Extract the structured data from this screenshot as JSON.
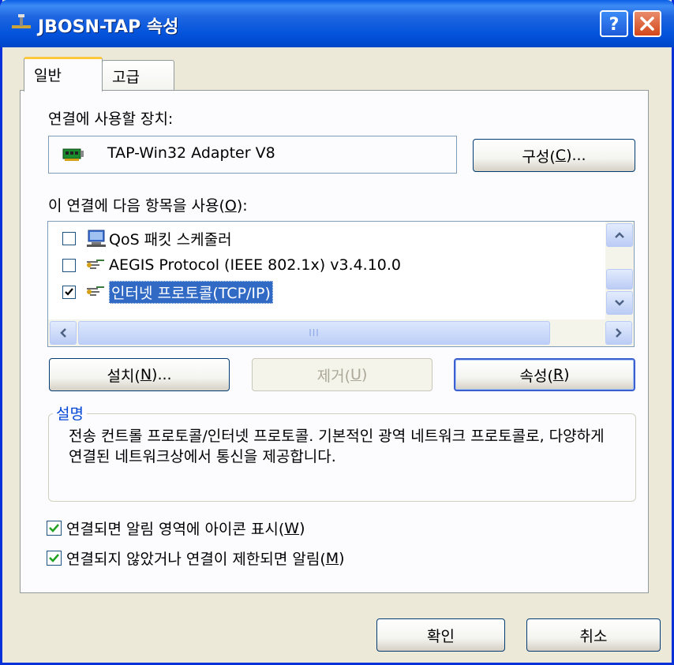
{
  "window": {
    "title": "JBOSN-TAP 속성",
    "help_icon": "help-icon",
    "close_icon": "close-icon"
  },
  "tabs": [
    {
      "label": "일반",
      "active": true
    },
    {
      "label": "고급",
      "active": false
    }
  ],
  "device": {
    "label": "연결에 사용할 장치:",
    "name": "TAP-Win32 Adapter V8",
    "icon": "network-adapter-icon",
    "configure_button": {
      "text": "구성(",
      "key": "C",
      "suffix": ")..."
    }
  },
  "items_section": {
    "label_text": "이 연결에 다음 항목을 사용(",
    "label_key": "O",
    "label_suffix": "):",
    "items": [
      {
        "label": "QoS 패킷 스케줄러",
        "checked": false,
        "icon": "qos-scheduler-icon",
        "selected": false
      },
      {
        "label": "AEGIS Protocol (IEEE 802.1x) v3.4.10.0",
        "checked": false,
        "icon": "protocol-icon",
        "selected": false
      },
      {
        "label": "인터넷 프로토콜(TCP/IP)",
        "checked": true,
        "icon": "protocol-icon",
        "selected": true
      }
    ],
    "hscroll_grip": "III"
  },
  "buttons": {
    "install": {
      "text": "설치(",
      "key": "N",
      "suffix": ")..."
    },
    "remove": {
      "text": "제거(",
      "key": "U",
      "suffix": ")"
    },
    "properties": {
      "text": "속성(",
      "key": "R",
      "suffix": ")"
    }
  },
  "description": {
    "legend": "설명",
    "text": "전송 컨트롤 프로토콜/인터넷 프로토콜. 기본적인 광역 네트워크 프로토콜로, 다양하게 연결된 네트워크상에서 통신을 제공합니다."
  },
  "options": [
    {
      "text": "연결되면 알림 영역에 아이콘 표시(",
      "key": "W",
      "suffix": ")",
      "checked": true
    },
    {
      "text": "연결되지 않았거나 연결이 제한되면 알림(",
      "key": "M",
      "suffix": ")",
      "checked": true
    }
  ],
  "footer": {
    "ok": "확인",
    "cancel": "취소"
  },
  "colors": {
    "titlebar": "#0A5FE6",
    "selection": "#316AC5",
    "window_bg": "#ECE9D8",
    "group_legend": "#0046D5"
  }
}
